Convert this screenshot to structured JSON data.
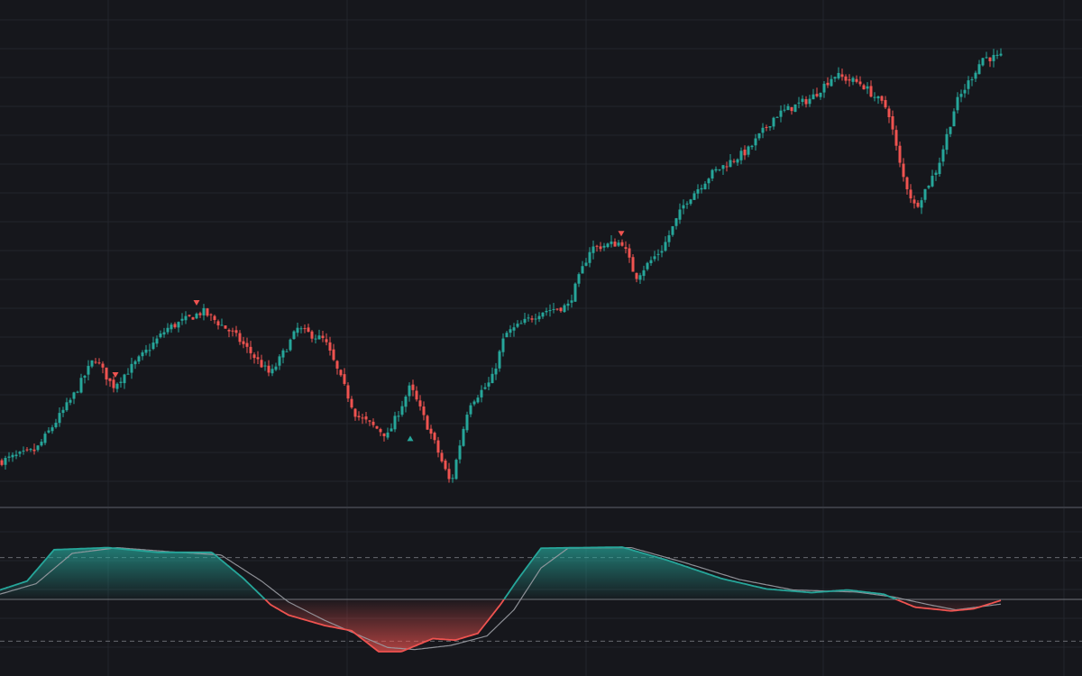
{
  "colors": {
    "background": "#16171c",
    "grid": "#23252c",
    "separator": "#3a3c44",
    "up": "#26a69a",
    "down": "#ef5350",
    "signal_line": "#9a9ca3",
    "zero_line": "#8a8c93",
    "dashed_level": "#6f7178"
  },
  "chart_data": [
    {
      "type": "candlestick",
      "title": "",
      "xlabel": "",
      "ylabel": "",
      "grid": true,
      "x_range": [
        0,
        1200
      ],
      "ylim": [
        0,
        100
      ],
      "key_points": [
        [
          0,
          20.0
        ],
        [
          40,
          22.0
        ],
        [
          80,
          31.0
        ],
        [
          105,
          38.0
        ],
        [
          125,
          33.0
        ],
        [
          150,
          37.0
        ],
        [
          185,
          43.0
        ],
        [
          225,
          46.0
        ],
        [
          260,
          42.0
        ],
        [
          300,
          35.0
        ],
        [
          330,
          43.0
        ],
        [
          360,
          41.0
        ],
        [
          395,
          28.0
        ],
        [
          430,
          24.5
        ],
        [
          455,
          33.0
        ],
        [
          480,
          24.0
        ],
        [
          500,
          16.0
        ],
        [
          520,
          30.0
        ],
        [
          545,
          34.0
        ],
        [
          560,
          42.0
        ],
        [
          600,
          46.0
        ],
        [
          630,
          47.0
        ],
        [
          655,
          57.0
        ],
        [
          690,
          58.0
        ],
        [
          705,
          52.0
        ],
        [
          735,
          57.0
        ],
        [
          760,
          65.0
        ],
        [
          790,
          70.0
        ],
        [
          830,
          74.0
        ],
        [
          860,
          80.0
        ],
        [
          900,
          83.0
        ],
        [
          925,
          87.0
        ],
        [
          955,
          85.5
        ],
        [
          985,
          81.0
        ],
        [
          1000,
          70.0
        ],
        [
          1015,
          64.0
        ],
        [
          1040,
          71.0
        ],
        [
          1060,
          82.0
        ],
        [
          1090,
          90.0
        ],
        [
          1110,
          90.0
        ]
      ],
      "signals": [
        {
          "type": "sell",
          "x": 128,
          "price": 35.0
        },
        {
          "type": "sell",
          "x": 218,
          "price": 47.5
        },
        {
          "type": "buy",
          "x": 455,
          "price": 24.0
        },
        {
          "type": "sell",
          "x": 689,
          "price": 59.5
        }
      ]
    },
    {
      "type": "area",
      "title": "",
      "ylim": [
        -1.15,
        1.15
      ],
      "levels": [
        0.0,
        0.8,
        -0.8
      ],
      "series": [
        {
          "role": "oscillator",
          "points": [
            [
              0,
              0.18
            ],
            [
              30,
              0.35
            ],
            [
              60,
              0.95
            ],
            [
              120,
              0.99
            ],
            [
              175,
              0.9
            ],
            [
              235,
              0.9
            ],
            [
              270,
              0.4
            ],
            [
              300,
              -0.1
            ],
            [
              320,
              -0.3
            ],
            [
              360,
              -0.5
            ],
            [
              390,
              -0.6
            ],
            [
              420,
              -1.0
            ],
            [
              445,
              -1.0
            ],
            [
              480,
              -0.75
            ],
            [
              505,
              -0.78
            ],
            [
              530,
              -0.65
            ],
            [
              555,
              -0.1
            ],
            [
              575,
              0.4
            ],
            [
              600,
              0.98
            ],
            [
              690,
              1.0
            ],
            [
              740,
              0.75
            ],
            [
              800,
              0.4
            ],
            [
              850,
              0.2
            ],
            [
              900,
              0.13
            ],
            [
              940,
              0.18
            ],
            [
              980,
              0.1
            ],
            [
              1015,
              -0.15
            ],
            [
              1055,
              -0.22
            ],
            [
              1080,
              -0.18
            ],
            [
              1110,
              -0.02
            ]
          ]
        },
        {
          "role": "signal",
          "points": [
            [
              0,
              0.1
            ],
            [
              40,
              0.3
            ],
            [
              80,
              0.88
            ],
            [
              130,
              0.99
            ],
            [
              190,
              0.91
            ],
            [
              245,
              0.85
            ],
            [
              290,
              0.35
            ],
            [
              320,
              -0.05
            ],
            [
              360,
              -0.4
            ],
            [
              400,
              -0.7
            ],
            [
              430,
              -0.92
            ],
            [
              460,
              -0.96
            ],
            [
              500,
              -0.88
            ],
            [
              540,
              -0.7
            ],
            [
              570,
              -0.2
            ],
            [
              600,
              0.6
            ],
            [
              630,
              0.98
            ],
            [
              700,
              0.99
            ],
            [
              760,
              0.7
            ],
            [
              820,
              0.38
            ],
            [
              880,
              0.18
            ],
            [
              950,
              0.14
            ],
            [
              990,
              0.05
            ],
            [
              1030,
              -0.1
            ],
            [
              1060,
              -0.2
            ],
            [
              1110,
              -0.09
            ]
          ]
        }
      ]
    }
  ]
}
